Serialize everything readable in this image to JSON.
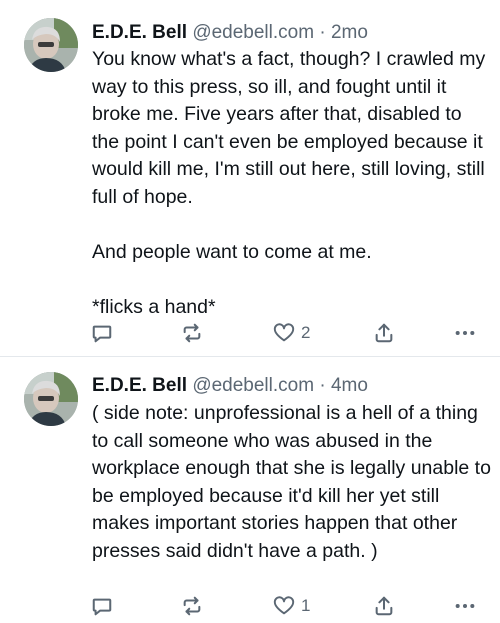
{
  "posts": [
    {
      "author": "E.D.E. Bell",
      "handle": "@edebell.com",
      "separator": "·",
      "time": "2mo",
      "text": "You know what's a fact, though? I crawled my way to this press, so ill, and fought until it broke me. Five years after that, disabled to the point I can't even be employed because it would kill me, I'm still out here, still loving, still full of hope.\n\nAnd people want to come at me.\n\n*flicks a hand*",
      "like_count": "2"
    },
    {
      "author": "E.D.E. Bell",
      "handle": "@edebell.com",
      "separator": "·",
      "time": "4mo",
      "text": "( side note: unprofessional is a hell of a thing to call someone who was abused in the workplace enough that she is legally unable to be employed because it'd kill her yet still makes important stories happen that other presses said didn't have a path. )",
      "like_count": "1"
    }
  ],
  "icons": {
    "reply": "reply-icon",
    "repost": "repost-icon",
    "like": "heart-icon",
    "share": "share-icon",
    "more": "more-icon"
  },
  "colors": {
    "text": "#0f1419",
    "muted": "#5b6773",
    "divider": "#e4e8ec"
  }
}
